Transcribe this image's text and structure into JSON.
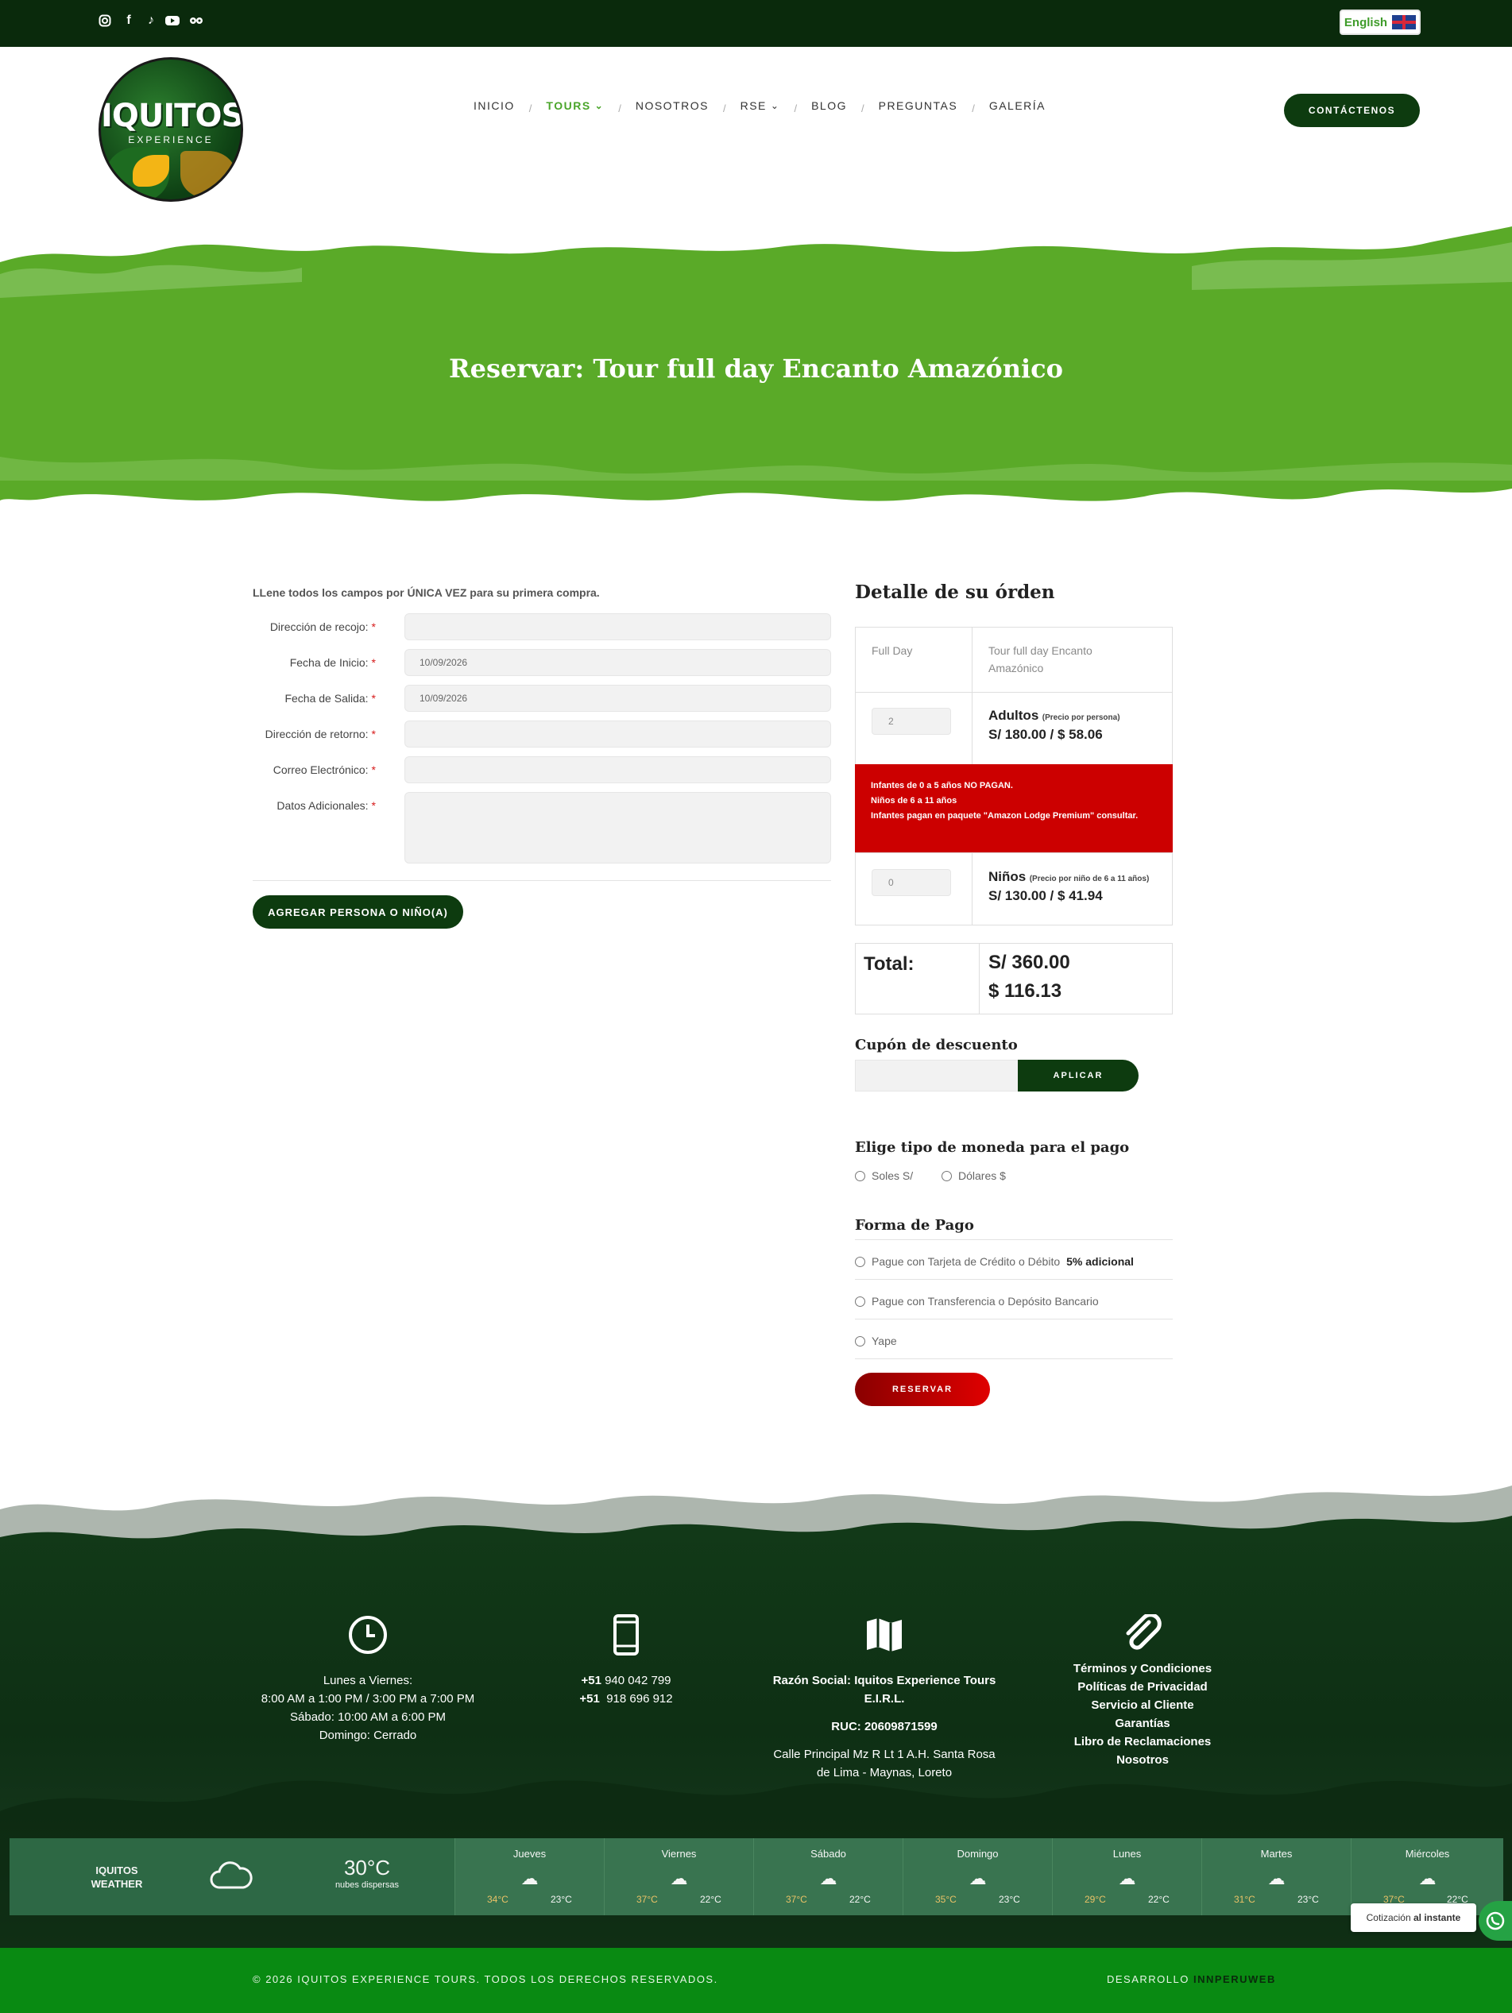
{
  "topbar": {
    "social_icons": [
      "instagram-icon",
      "facebook-icon",
      "tiktok-icon",
      "youtube-icon",
      "tripadvisor-icon"
    ],
    "language_label": "English"
  },
  "header": {
    "logo_title": "IQUITOS",
    "logo_subtitle": "EXPERIENCE",
    "nav": [
      "INICIO",
      "TOURS",
      "NOSOTROS",
      "RSE",
      "BLOG",
      "PREGUNTAS",
      "GALERÍA"
    ],
    "active_nav": "TOURS",
    "contact_label": "CONTÁCTENOS"
  },
  "banner": {
    "title": "Reservar: Tour full day Encanto Amazónico",
    "color": "#5aaa28"
  },
  "form": {
    "intro": "LLene todos los campos por ÚNICA VEZ para su primera compra.",
    "fields": [
      {
        "label": "Dirección de recojo:",
        "value": ""
      },
      {
        "label": "Fecha de Inicio:",
        "value": "10/09/2026"
      },
      {
        "label": "Fecha de Salida:",
        "value": "10/09/2026"
      },
      {
        "label": "Dirección de retorno:",
        "value": ""
      },
      {
        "label": "Correo Electrónico:",
        "value": ""
      },
      {
        "label": "Datos Adicionales:",
        "value": ""
      }
    ],
    "required_mark": "*",
    "add_person_label": "AGREGAR PERSONA O NIÑO(A)"
  },
  "order": {
    "title": "Detalle de su órden",
    "tour_type": "Full Day",
    "tour_name": "Tour full day Encanto Amazónico",
    "adults": {
      "qty": "2",
      "label": "Adultos",
      "note": "(Precio por persona)",
      "price": "S/ 180.00 / $ 58.06"
    },
    "notice": [
      "Infantes de 0 a 5 años NO PAGAN.",
      "Niños de 6 a 11 años",
      "Infantes pagan en paquete \"Amazon Lodge Premium\" consultar."
    ],
    "children": {
      "qty": "0",
      "label": "Niños",
      "note": "(Precio por niño de 6 a 11 años)",
      "price": "S/ 130.00 / $ 41.94"
    },
    "total_label": "Total:",
    "total_soles": "S/ 360.00",
    "total_dollars": "$ 116.13",
    "coupon_title": "Cupón de descuento",
    "coupon_button": "APLICAR",
    "currency_title": "Elige tipo de moneda para el pago",
    "currency_options": [
      "Soles S/",
      "Dólares $"
    ],
    "payment_title": "Forma de Pago",
    "payment_card": "Pague con Tarjeta de Crédito o Débito",
    "payment_card_extra": "5% adicional",
    "payment_transfer": "Pague con Transferencia o Depósito Bancario",
    "payment_yape": "Yape",
    "reserve_button": "RESERVAR"
  },
  "footer": {
    "hours": [
      "Lunes a Viernes:",
      "8:00 AM a 1:00 PM / 3:00 PM a 7:00 PM",
      "Sábado: 10:00 AM a 6:00 PM",
      "Domingo: Cerrado"
    ],
    "phones": [
      {
        "code": "+51",
        "number": "940 042 799"
      },
      {
        "code": "+51",
        "number": "918 696 912"
      }
    ],
    "company": "Razón Social: Iquitos Experience Tours E.I.R.L.",
    "ruc": "RUC: 20609871599",
    "address": "Calle Principal Mz R Lt 1 A.H. Santa Rosa de Lima - Maynas, Loreto",
    "links": [
      "Términos y Condiciones",
      "Políticas de Privacidad",
      "Servicio al Cliente",
      "Garantías",
      "Libro de Reclamaciones",
      "Nosotros"
    ]
  },
  "weather": {
    "city_line1": "IQUITOS",
    "city_line2": "WEATHER",
    "current_temp": "30°C",
    "current_desc": "nubes dispersas",
    "days": [
      {
        "name": "Jueves",
        "hi": "34°C",
        "lo": "23°C"
      },
      {
        "name": "Viernes",
        "hi": "37°C",
        "lo": "22°C"
      },
      {
        "name": "Sábado",
        "hi": "37°C",
        "lo": "22°C"
      },
      {
        "name": "Domingo",
        "hi": "35°C",
        "lo": "23°C"
      },
      {
        "name": "Lunes",
        "hi": "29°C",
        "lo": "22°C"
      },
      {
        "name": "Martes",
        "hi": "31°C",
        "lo": "23°C"
      },
      {
        "name": "Miércoles",
        "hi": "37°C",
        "lo": "22°C"
      }
    ]
  },
  "chat": {
    "label_prefix": "Cotización",
    "label_bold": "al instante"
  },
  "bottom": {
    "copyright": "© 2026 IQUITOS EXPERIENCE TOURS. TODOS LOS DERECHOS RESERVADOS.",
    "dev_prefix": "DESARROLLO",
    "dev_brand": "INNPERUWEB"
  }
}
